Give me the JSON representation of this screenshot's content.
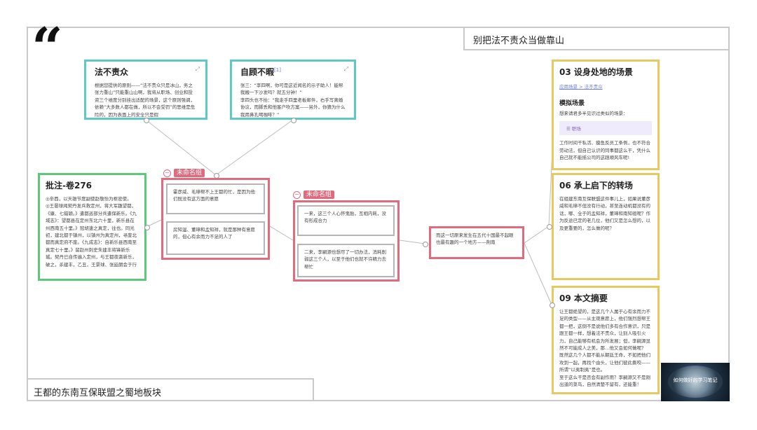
{
  "header": {
    "title": "别把法不责众当做靠山",
    "quote_glyph": "“"
  },
  "footer": {
    "title": "王都的东南互保联盟之蜀地板块"
  },
  "cards": {
    "fabuzezhong": {
      "title": "法不责众",
      "body": "根据您提供的原则——“法不责众只是冰山，务之张力重山”只能重山山啊，我将从职场、创业和投资三个维度分别挂出适配的场景，这个原则强调，依赖“大多数人都在做，所以不会受罚”的思维是危险的，因为表面上的安全只是假"
    },
    "zigubuxia": {
      "title": "自顾不暇",
      "sup": "[1]",
      "body": "张三：“李四啊，你可是这近闻名的示子助人！能帮我搬一下沙发吗？就五分钟！”\n李四头也不抬：“我走手四里老板邮件，右手写离婚协议，而脚丢和他客户吹方案——另外，你猜为什么我用鼻孔喝咖啡？”"
    },
    "pizhu": {
      "title": "批注-卷276",
      "body": "◎辛酉，以天雄节度副使赵敬怡为枢密使。\n◎王晏球闻契丹发兵救定州，将大军趣望都，《康、七蜡颖。》遣都巡部分兵遣保新乐。《九域志》：望都县在定州东北六十里，新乐县在州西南五十里。》冠胡速之真定，往也。同光初，建北都于镇州，以镇州为真定州，寻废北都而真定府不废。《九成志》：自新乐县西南至真定七十里。》留赵州刺史朱建丰将锋新乐城。契丹已自传遍入定州，与王都夜袭新乐，破之，杀建丰，乙丑，王景球、张延朗会于行"
    },
    "scene03": {
      "title": "03 设身处地的场景",
      "link": "应用场景 > 法不责众",
      "subtitle": "模拟场景",
      "lead": "想来请君多半见识过类似的场景：",
      "chip": "☰ 职场",
      "body": "工作时间干私活、摸鱼反员工条例，也不符合劳动法，但自己认识的同事都这么干，凭什么自己就不能摇公司的这趟顺风车呢!"
    },
    "zhuanzhe06": {
      "title": "06 承上启下的转场",
      "body": "在组建东南互保联盟这件事儿上，如果说董彦威和毛璋不但没有行动，甚至连动机都没有的话，哪、全于的孟知祥，董璋和南知祖呢？作为反途已定的老几位，他们又是怎么想的，以及更重要的，怎么做的呢？"
    },
    "summary09": {
      "title": "09 本文摘要",
      "body": "让王都绝望的，是这几个人属于心有余而力不足的类型——从主观意愿上，他们强烈想帮王都一把，这倒不是说他们多有合作意识，只是跟王都一样，想着法不责众，让别人吸引火力，自己能够有机会为所发展；但，李嗣源显然不可能成人之美，那…他又会如何做呢？\n既然这几个人都不能从朝廷王命，不如把他们攻到一起，再找个由头，让他们彼此撕咬——所谓“以夷制夷”是也。\n至于这么干是否会有副作用？李嗣源又不是刚出道的菜鸟，自然清楚不留有，还能重！"
    }
  },
  "groups": [
    {
      "label": "未命名组",
      "notes": [
        "霍彦威、毛璋帮不上王都的忙，是因为他们既没有这方面的意愿",
        "房知温、董璋和孟知祥，就是那种有意愿的，但心有余而力不足的人了"
      ]
    },
    {
      "label": "未命名组",
      "notes": [
        "一来，这三个人心怀鬼胎，互相内耗，没有形成合力",
        "二来，李嗣源也想尽了一切办法，消耗削弱这三个人，以至于他们也就不许精力去帮忙"
      ]
    }
  ],
  "center_note": "而这一切原来发生在五代十国最不起眼也最有趣的一个地方——荆南",
  "thumbnail": {
    "caption": "如何做好的学习笔记"
  },
  "colors": {
    "teal": "#5cc8c8",
    "green": "#5cc87a",
    "gold": "#e8c860",
    "red": "#e06b7e",
    "frame": "#c9c9c9"
  },
  "icons": {
    "expand": "expand-icon",
    "collapse": "collapse-group-icon"
  }
}
